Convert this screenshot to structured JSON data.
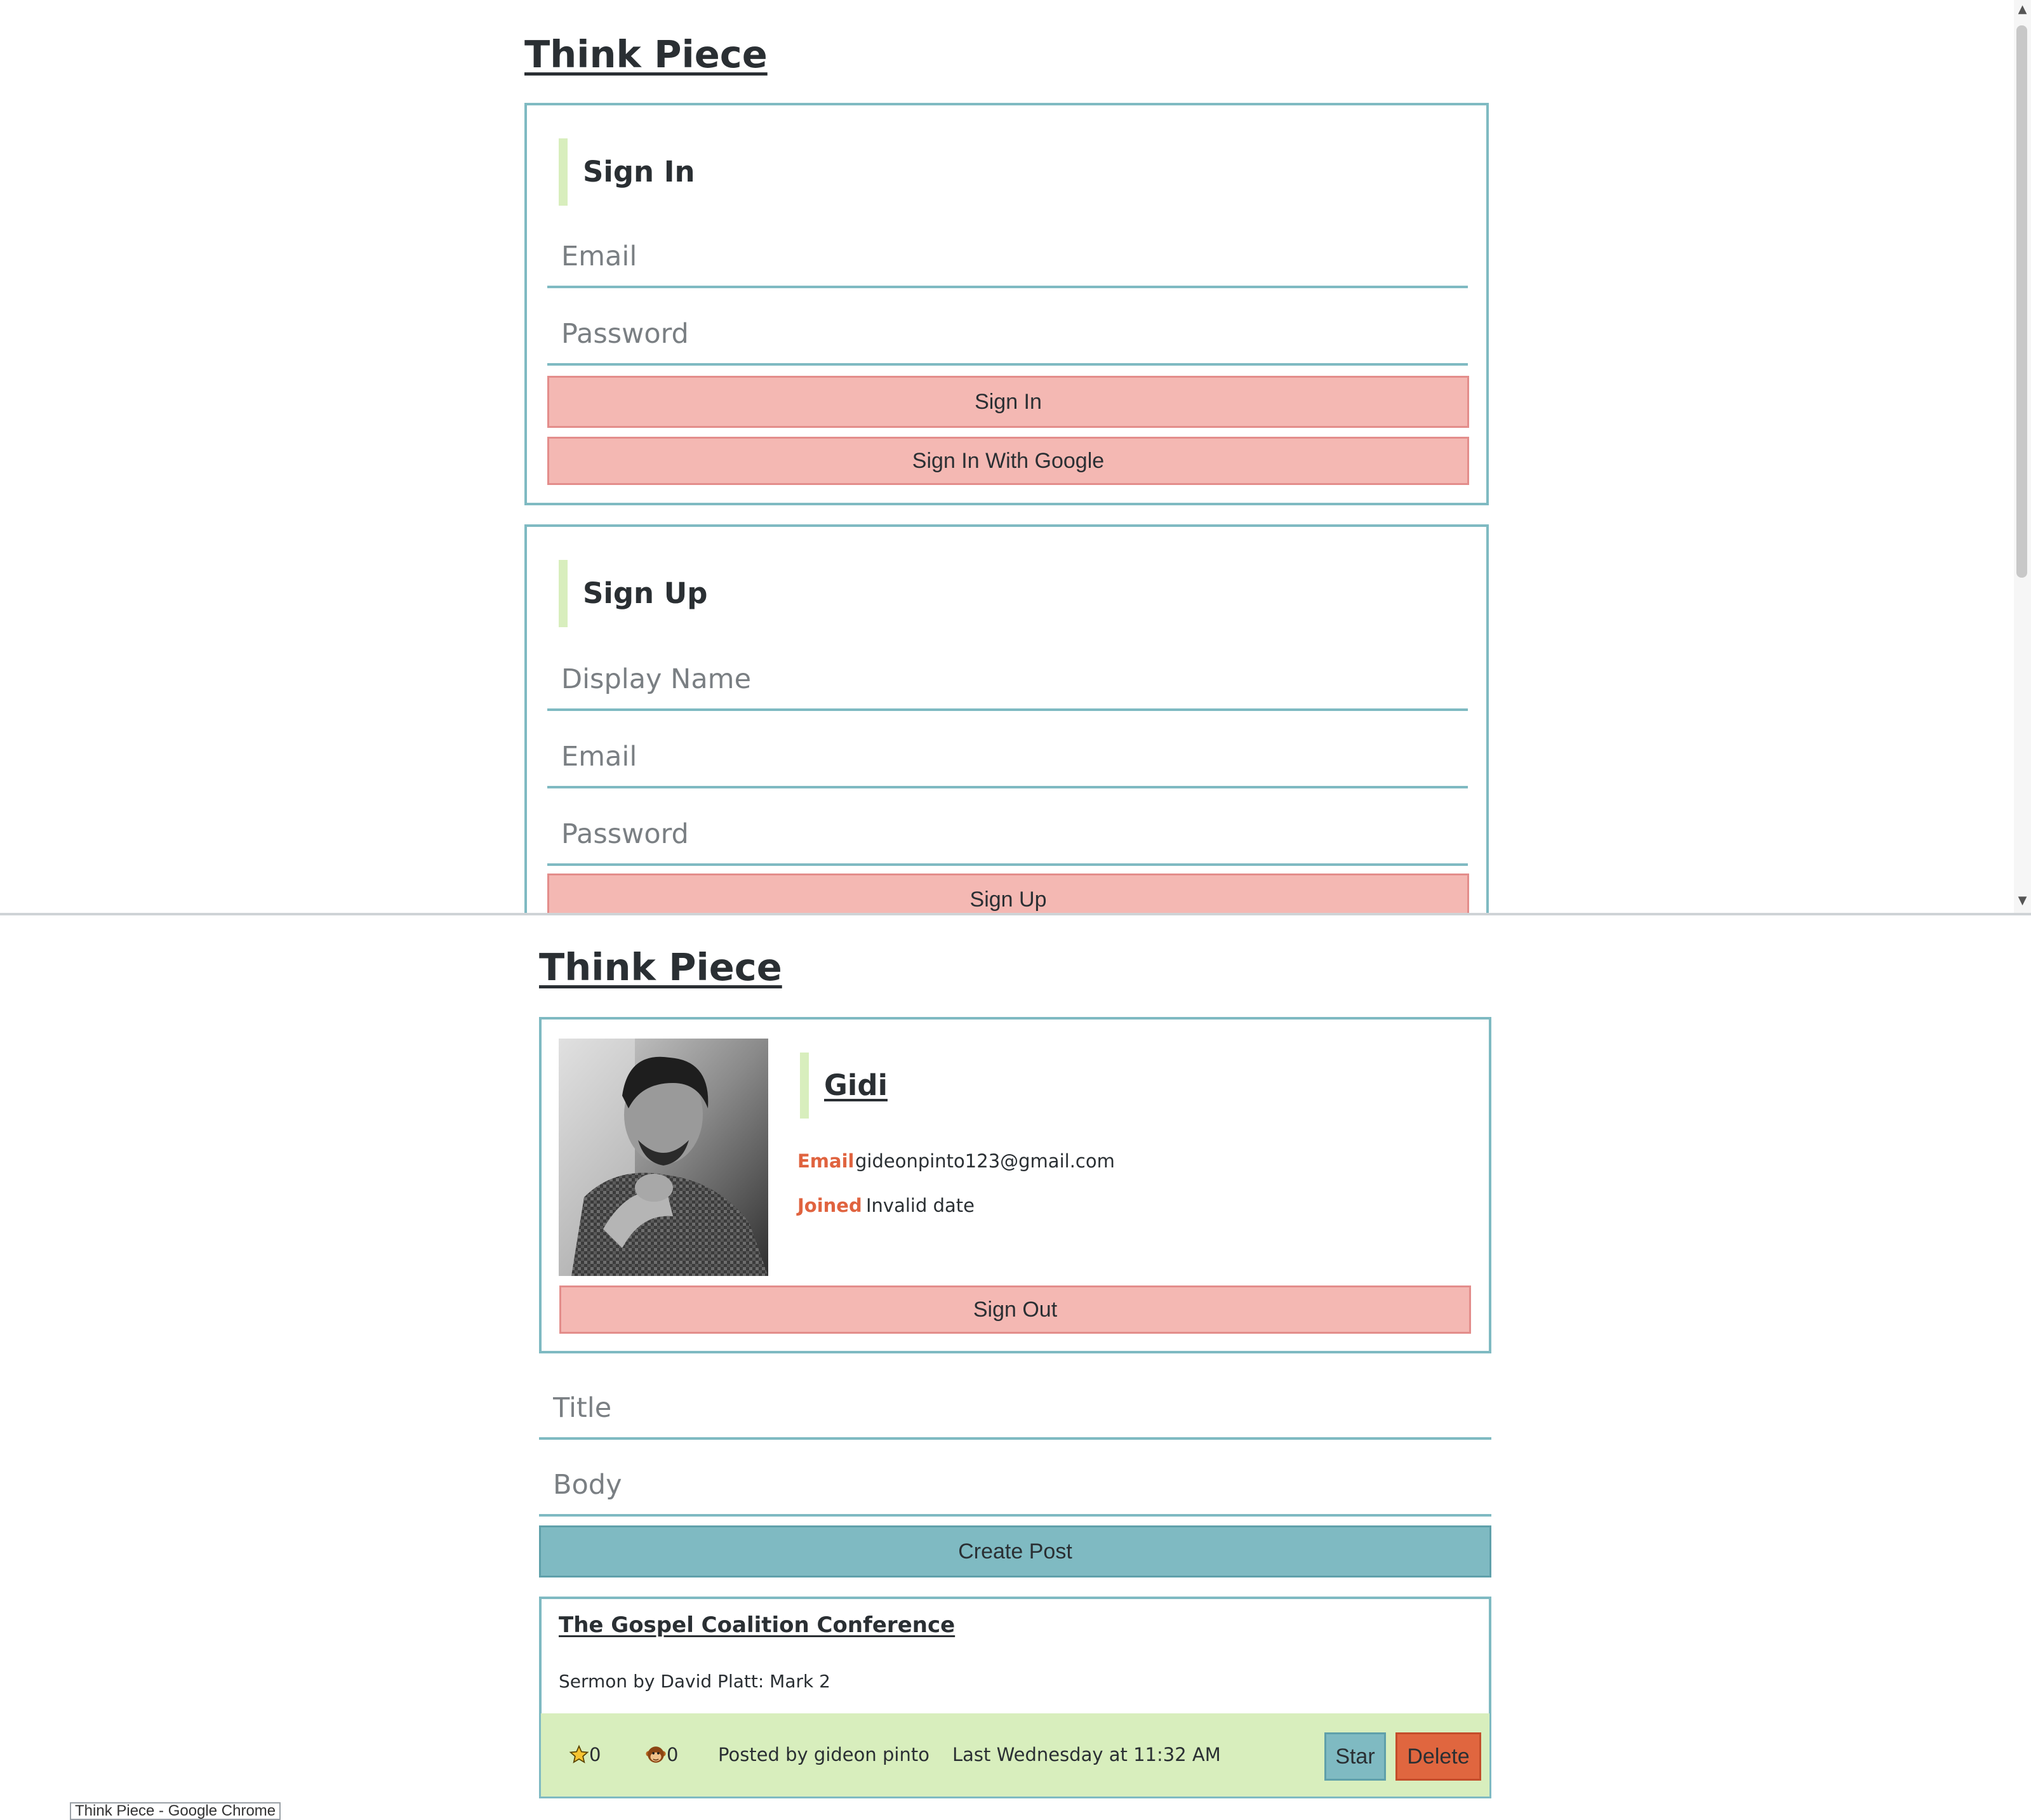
{
  "app": {
    "title": "Think Piece"
  },
  "signin": {
    "heading": "Sign In",
    "email_placeholder": "Email",
    "password_placeholder": "Password",
    "submit_label": "Sign In",
    "google_label": "Sign In With Google"
  },
  "signup": {
    "heading": "Sign Up",
    "display_name_placeholder": "Display Name",
    "email_placeholder": "Email",
    "password_placeholder": "Password",
    "submit_label": "Sign Up"
  },
  "profile": {
    "display_name": "Gidi",
    "email_label": "Email",
    "email_value": "gideonpinto123@gmail.com",
    "joined_label": "Joined",
    "joined_value": "Invalid date",
    "signout_label": "Sign Out"
  },
  "create_post": {
    "title_placeholder": "Title",
    "body_placeholder": "Body",
    "submit_label": "Create Post"
  },
  "posts": [
    {
      "title": "The Gospel Coalition Conference",
      "body": "Sermon by David Platt: Mark 2",
      "stars": "0",
      "comments": "0",
      "author": "Posted by gideon pinto",
      "time": "Last Wednesday at 11:32 AM",
      "star_label": "Star",
      "delete_label": "Delete"
    }
  ],
  "taskbar": {
    "tooltip": "Think Piece - Google Chrome"
  },
  "icons": {
    "star": "star-icon",
    "comments": "monkey-face-icon"
  },
  "colors": {
    "accent_teal": "#7fbac2",
    "button_pink": "#f4b8b3",
    "heading_bar": "#d8eebd",
    "label_orange": "#e0633f",
    "delete_orange": "#e0663f"
  }
}
